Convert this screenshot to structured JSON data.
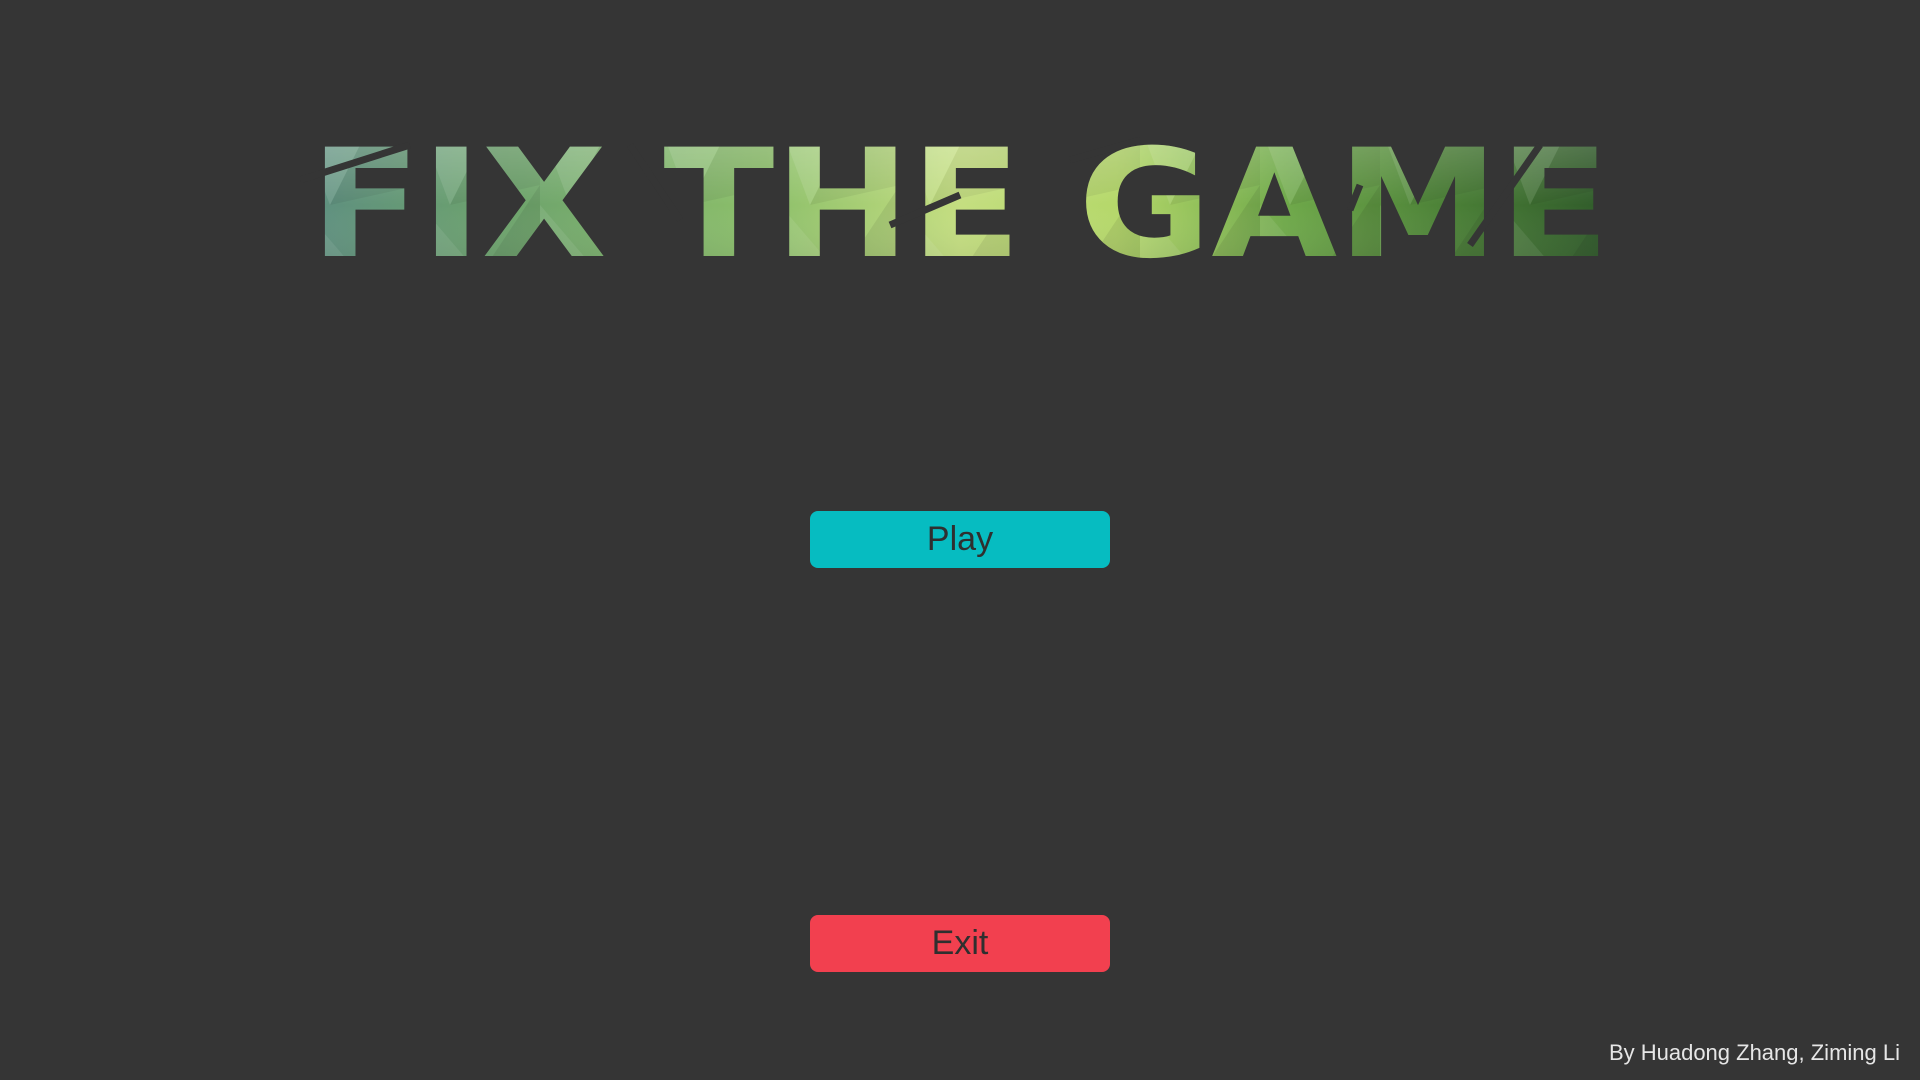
{
  "title": {
    "text": "FIX THE GAME"
  },
  "menu": {
    "play_label": "Play",
    "exit_label": "Exit"
  },
  "credits": "By Huadong Zhang, Ziming Li",
  "colors": {
    "background": "#353535",
    "play_button": "#06bcc1",
    "exit_button": "#f2404f",
    "button_text": "#2f2f2f",
    "credits_text": "#e6e6e6",
    "title_palette": [
      "#5a917f",
      "#6fa86a",
      "#8cc36a",
      "#c8e07a",
      "#a6d05e",
      "#4f8a3c",
      "#3a6b2c",
      "#1e2b1e"
    ]
  }
}
